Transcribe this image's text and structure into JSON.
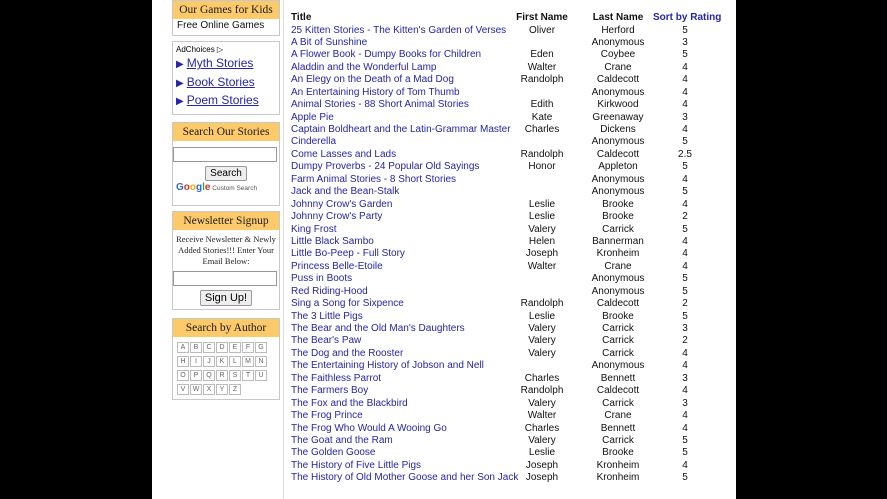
{
  "sidebar": {
    "games": {
      "header": "Our Games for Kids",
      "link": "Free Online Games"
    },
    "ads": {
      "adchoices": "AdChoices",
      "links": [
        "Myth Stories",
        "Book Stories",
        "Poem Stories"
      ]
    },
    "search": {
      "header": "Search Our Stories",
      "button": "Search",
      "powered": "Custom Search",
      "google": [
        "G",
        "o",
        "o",
        "g",
        "l",
        "e"
      ]
    },
    "newsletter": {
      "header": "Newsletter Signup",
      "text": "Receive Newsletter & Newly Added Stories!!! Enter Your Email Below:",
      "button": "Sign Up!"
    },
    "authors": {
      "header": "Search by Author",
      "letters": [
        "A",
        "B",
        "C",
        "D",
        "E",
        "F",
        "G",
        "H",
        "I",
        "J",
        "K",
        "L",
        "M",
        "N",
        "O",
        "P",
        "Q",
        "R",
        "S",
        "T",
        "U",
        "V",
        "W",
        "X",
        "Y",
        "Z"
      ]
    }
  },
  "table": {
    "headers": {
      "title": "Title",
      "first": "First Name",
      "last": "Last Name",
      "rating": "Sort by Rating"
    },
    "rows": [
      {
        "title": "25 Kitten Stories - The Kitten's Garden of Verses",
        "first": "Oliver",
        "last": "Herford",
        "rating": "5"
      },
      {
        "title": "A Bit of Sunshine",
        "first": "",
        "last": "Anonymous",
        "rating": "3"
      },
      {
        "title": "A Flower Book - Dumpy Books for Children",
        "first": "Eden",
        "last": "Coybee",
        "rating": "5"
      },
      {
        "title": "Aladdin and the Wonderful Lamp",
        "first": "Walter",
        "last": "Crane",
        "rating": "4"
      },
      {
        "title": "An Elegy on the Death of a Mad Dog",
        "first": "Randolph",
        "last": "Caldecott",
        "rating": "4"
      },
      {
        "title": "An Entertaining History of Tom Thumb",
        "first": "",
        "last": "Anonymous",
        "rating": "4"
      },
      {
        "title": "Animal Stories - 88 Short Animal Stories",
        "first": "Edith",
        "last": "Kirkwood",
        "rating": "4"
      },
      {
        "title": "Apple Pie",
        "first": "Kate",
        "last": "Greenaway",
        "rating": "3"
      },
      {
        "title": "Captain Boldheart and the Latin-Grammar Master",
        "first": "Charles",
        "last": "Dickens",
        "rating": "4"
      },
      {
        "title": "Cinderella",
        "first": "",
        "last": "Anonymous",
        "rating": "5"
      },
      {
        "title": "Come Lasses and Lads",
        "first": "Randolph",
        "last": "Caldecott",
        "rating": "2.5"
      },
      {
        "title": "Dumpy Proverbs - 24 Popular Old Sayings",
        "first": "Honor",
        "last": "Appleton",
        "rating": "5"
      },
      {
        "title": "Farm Animal Stories - 8 Short Stories",
        "first": "",
        "last": "Anonymous",
        "rating": "4"
      },
      {
        "title": "Jack and the Bean-Stalk",
        "first": "",
        "last": "Anonymous",
        "rating": "5"
      },
      {
        "title": "Johnny Crow's Garden",
        "first": "Leslie",
        "last": "Brooke",
        "rating": "4"
      },
      {
        "title": "Johnny Crow's Party",
        "first": "Leslie",
        "last": "Brooke",
        "rating": "2"
      },
      {
        "title": "King Frost",
        "first": "Valery",
        "last": "Carrick",
        "rating": "5"
      },
      {
        "title": "Little Black Sambo",
        "first": "Helen",
        "last": "Bannerman",
        "rating": "4"
      },
      {
        "title": "Little Bo-Peep - Full Story",
        "first": "Joseph",
        "last": "Kronheim",
        "rating": "4"
      },
      {
        "title": "Princess Belle-Etoile",
        "first": "Walter",
        "last": "Crane",
        "rating": "4"
      },
      {
        "title": "Puss in Boots",
        "first": "",
        "last": "Anonymous",
        "rating": "5"
      },
      {
        "title": "Red Riding-Hood",
        "first": "",
        "last": "Anonymous",
        "rating": "5"
      },
      {
        "title": "Sing a Song for Sixpence",
        "first": "Randolph",
        "last": "Caldecott",
        "rating": "2"
      },
      {
        "title": "The 3 Little Pigs",
        "first": "Leslie",
        "last": "Brooke",
        "rating": "5"
      },
      {
        "title": "The Bear and the Old Man's Daughters",
        "first": "Valery",
        "last": "Carrick",
        "rating": "3"
      },
      {
        "title": "The Bear's Paw",
        "first": "Valery",
        "last": "Carrick",
        "rating": "2"
      },
      {
        "title": "The Dog and the Rooster",
        "first": "Valery",
        "last": "Carrick",
        "rating": "4"
      },
      {
        "title": "The Entertaining History of Jobson and Nell",
        "first": "",
        "last": "Anonymous",
        "rating": "4"
      },
      {
        "title": "The Faithless Parrot",
        "first": "Charles",
        "last": "Bennett",
        "rating": "3"
      },
      {
        "title": "The Farmers Boy",
        "first": "Randolph",
        "last": "Caldecott",
        "rating": "4"
      },
      {
        "title": "The Fox and the Blackbird",
        "first": "Valery",
        "last": "Carrick",
        "rating": "3"
      },
      {
        "title": "The Frog Prince",
        "first": "Walter",
        "last": "Crane",
        "rating": "4"
      },
      {
        "title": "The Frog Who Would A Wooing Go",
        "first": "Charles",
        "last": "Bennett",
        "rating": "4"
      },
      {
        "title": "The Goat and the Ram",
        "first": "Valery",
        "last": "Carrick",
        "rating": "5"
      },
      {
        "title": "The Golden Goose",
        "first": "Leslie",
        "last": "Brooke",
        "rating": "5"
      },
      {
        "title": "The History of Five Little Pigs",
        "first": "Joseph",
        "last": "Kronheim",
        "rating": "4"
      },
      {
        "title": "The History of Old Mother Goose and her Son Jack",
        "first": "Joseph",
        "last": "Kronheim",
        "rating": "5"
      }
    ]
  }
}
